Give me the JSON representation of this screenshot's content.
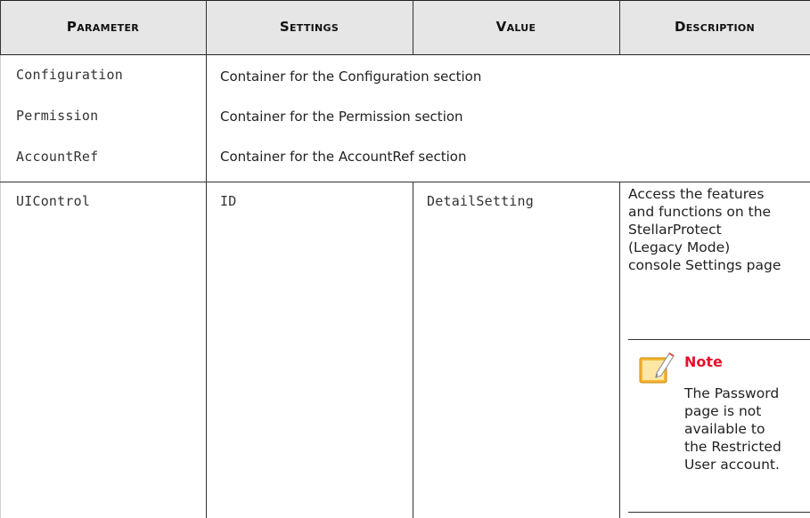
{
  "table": {
    "headers": {
      "parameter": "Parameter",
      "settings": "Settings",
      "value": "Value",
      "description": "Description"
    },
    "section_rows": [
      {
        "parameter": "Configuration",
        "text": "Container for the Configuration section"
      },
      {
        "parameter": "Permission",
        "text": "Container for the Permission section"
      },
      {
        "parameter": "AccountRef",
        "text": "Container for the AccountRef section"
      }
    ],
    "uicontrol_row": {
      "parameter": "UIControl",
      "settings": "ID",
      "value": "DetailSetting",
      "description_lines": [
        "Access the features",
        "and functions on the",
        "StellarProtect",
        "(Legacy Mode)",
        "console Settings page"
      ],
      "note": {
        "title": "Note",
        "icon": "note-pencil-icon",
        "body_lines": [
          "The Password",
          "page is not",
          "available to",
          "the Restricted",
          "User account."
        ]
      }
    }
  },
  "colors": {
    "header_bg": "#e6e6e6",
    "note_title": "#e8112d",
    "note_icon": "#f6b733"
  }
}
